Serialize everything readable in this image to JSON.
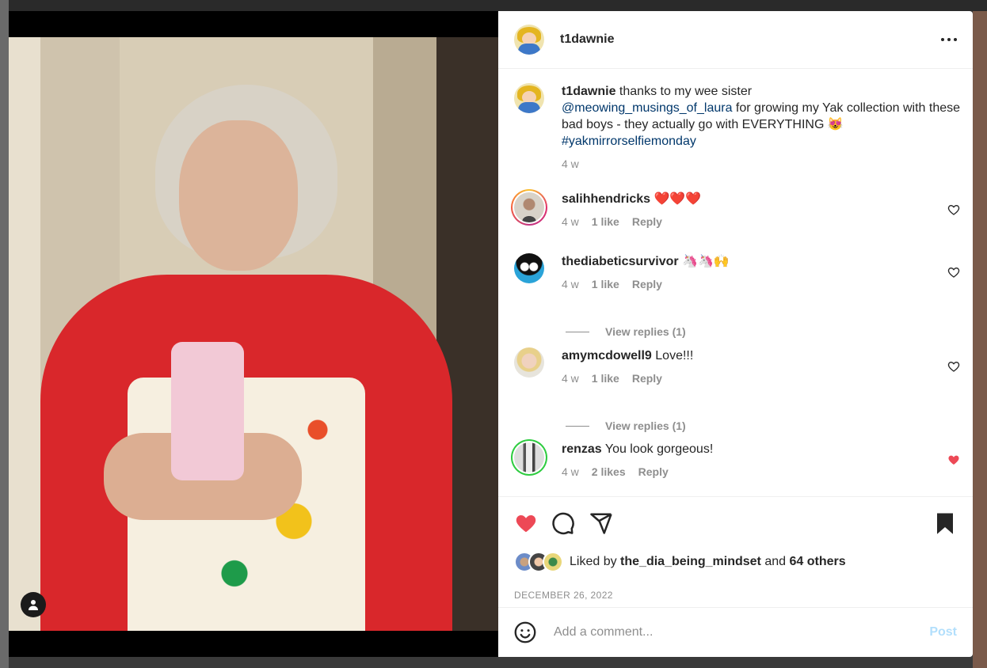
{
  "post": {
    "author": "t1dawnie",
    "caption": {
      "username": "t1dawnie",
      "text_1": "thanks to my wee sister",
      "mention": "@meowing_musings_of_laura",
      "text_2": "for growing my Yak collection with these bad boys - they actually go with EVERYTHING 😻",
      "hashtag": "#yakmirrorselfiemonday",
      "time": "4 w"
    },
    "comments": [
      {
        "username": "salihhendricks",
        "text": "❤️❤️❤️",
        "time": "4 w",
        "likes": "1 like",
        "reply": "Reply",
        "liked": false
      },
      {
        "username": "thediabeticsurvivor",
        "text": "🦄🦄🙌",
        "time": "4 w",
        "likes": "1 like",
        "reply": "Reply",
        "liked": false,
        "view_replies": "View replies (1)"
      },
      {
        "username": "amymcdowell9",
        "text": "Love!!!",
        "time": "4 w",
        "likes": "1 like",
        "reply": "Reply",
        "liked": false,
        "view_replies": "View replies (1)"
      },
      {
        "username": "renzas",
        "text": "You look gorgeous!",
        "time": "4 w",
        "likes": "2 likes",
        "reply": "Reply",
        "liked": true
      }
    ],
    "liked_by": {
      "prefix": "Liked by",
      "user": "the_dia_being_mindset",
      "middle": "and",
      "others": "64 others"
    },
    "date": "DECEMBER 26, 2022",
    "add_comment": {
      "placeholder": "Add a comment...",
      "post_label": "Post"
    },
    "icons": [
      "heart-filled-icon",
      "comment-icon",
      "share-icon",
      "bookmark-filled-icon",
      "emoji-icon",
      "more-icon",
      "user-tag-icon"
    ],
    "colors": {
      "heart": "#ed4956",
      "link": "#00376b",
      "post": "#b2dffc"
    }
  }
}
